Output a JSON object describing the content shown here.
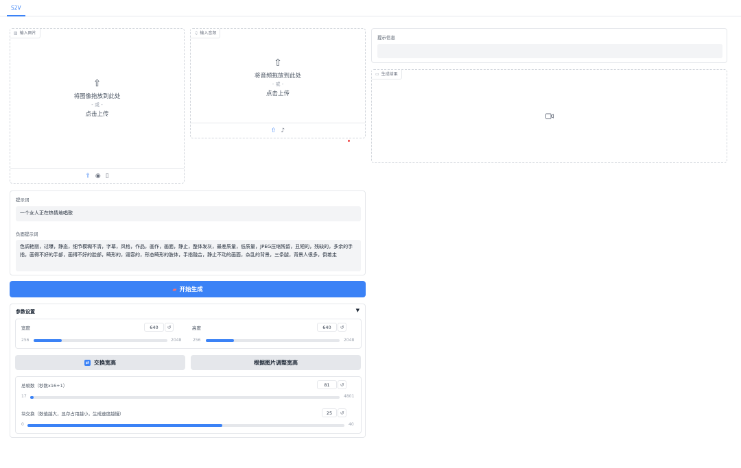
{
  "tabs": [
    {
      "label": "S2V"
    }
  ],
  "input_image": {
    "label": "输入图片",
    "drop_text": "将图像拖放到此处",
    "or_text": "- 或 -",
    "click_text": "点击上传"
  },
  "input_audio": {
    "label": "输入音频",
    "drop_text": "将音频拖放到此处",
    "or_text": "- 或 -",
    "click_text": "点击上传"
  },
  "info": {
    "label": "提示信息",
    "value": ""
  },
  "result": {
    "label": "生成结果"
  },
  "prompt": {
    "label": "提示词",
    "value": "一个女人正在热情地唱歌"
  },
  "negative_prompt": {
    "label": "负面提示词",
    "value": "色调艳丽，过曝，静态，细节模糊不清，字幕，风格，作品，画作，画面，静止，整体发灰，最差质量，低质量，JPEG压缩残留，丑陋的，残缺的，多余的手指，画得不好的手部，画得不好的脸部，畸形的，毁容的，形态畸形的肢体，手指融合，静止不动的画面，杂乱的背景，三条腿，背景人很多，倒着走"
  },
  "generate_button": {
    "label": "开始生成"
  },
  "params": {
    "title": "参数设置",
    "width": {
      "label": "宽度",
      "value": 640,
      "min": 256,
      "max": 2048
    },
    "height": {
      "label": "高度",
      "value": 640,
      "min": 256,
      "max": 2048
    },
    "swap_button": "交换宽高",
    "fit_button": "根据图片调整宽高",
    "frames": {
      "label": "总帧数（秒数x16+1）",
      "value": 81,
      "min": 17,
      "max": 4801
    },
    "block_swap": {
      "label": "块交换（数值越大，显存占用越小，生成速度越慢）",
      "value": 25,
      "min": 0,
      "max": 40
    }
  },
  "colors": {
    "accent": "#3b82f6",
    "border": "#e5e7eb",
    "field_bg": "#f3f4f6"
  }
}
